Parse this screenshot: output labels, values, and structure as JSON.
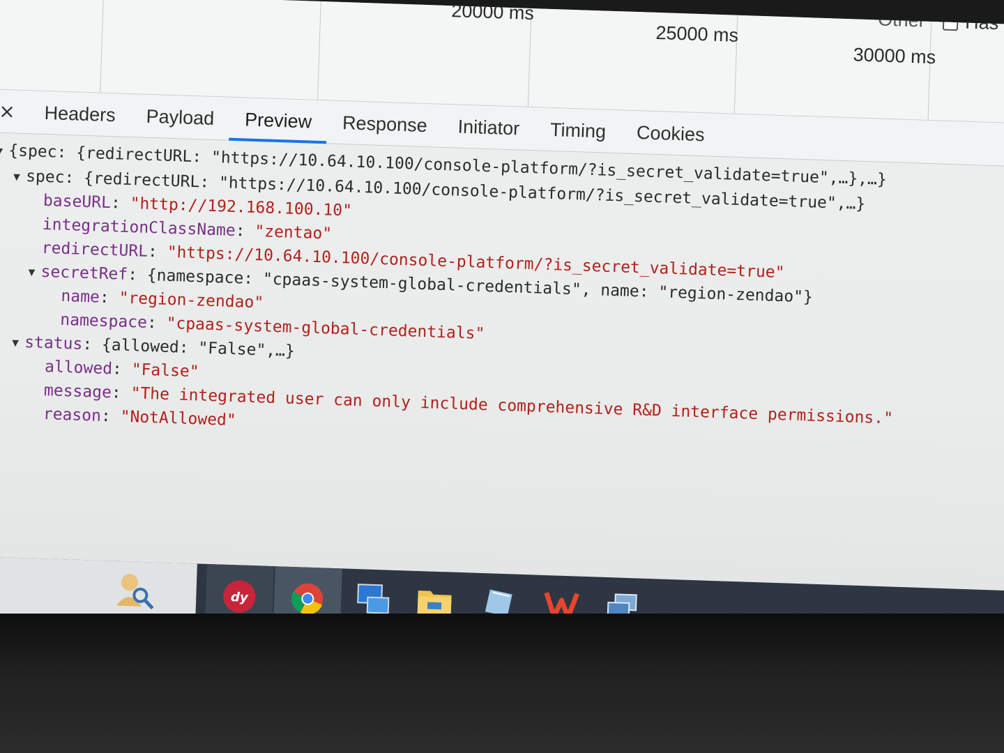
{
  "timeline": {
    "ticks": [
      "20000 ms",
      "25000 ms",
      "30000 ms"
    ],
    "other_label": "Other",
    "has_blocked_label": "Has blocke"
  },
  "tabs": {
    "close": "×",
    "items": [
      {
        "label": "Headers"
      },
      {
        "label": "Payload"
      },
      {
        "label": "Preview"
      },
      {
        "label": "Response"
      },
      {
        "label": "Initiator"
      },
      {
        "label": "Timing"
      },
      {
        "label": "Cookies"
      }
    ],
    "active": "Preview"
  },
  "preview": {
    "root": "{spec: {redirectURL: \"https://10.64.10.100/console-platform/?is_secret_validate=true\",…},…}",
    "spec_key": "spec",
    "spec_summary": "{redirectURL: \"https://10.64.10.100/console-platform/?is_secret_validate=true\",…}",
    "baseURL_key": "baseURL",
    "baseURL_val": "\"http://192.168.100.10\"",
    "icn_key": "integrationClassName",
    "icn_val": "\"zentao\"",
    "redirect_key": "redirectURL",
    "redirect_val": "\"https://10.64.10.100/console-platform/?is_secret_validate=true\"",
    "secretRef_key": "secretRef",
    "secretRef_summary": "{namespace: \"cpaas-system-global-credentials\", name: \"region-zendao\"}",
    "name_key": "name",
    "name_val": "\"region-zendao\"",
    "namespace_key": "namespace",
    "namespace_val": "\"cpaas-system-global-credentials\"",
    "status_key": "status",
    "status_summary": "{allowed: \"False\",…}",
    "allowed_key": "allowed",
    "allowed_val": "\"False\"",
    "message_key": "message",
    "message_val": "\"The integrated user can only include comprehensive R&D interface permissions.\"",
    "reason_key": "reason",
    "reason_val": "\"NotAllowed\""
  },
  "taskbar": {
    "icons": [
      "people-search-icon",
      "dingtalk-icon",
      "chrome-icon",
      "remote-desktop-icon",
      "file-explorer-icon",
      "notepad-icon",
      "wps-office-icon",
      "windows-switch-icon"
    ],
    "app_badge": "dy"
  }
}
